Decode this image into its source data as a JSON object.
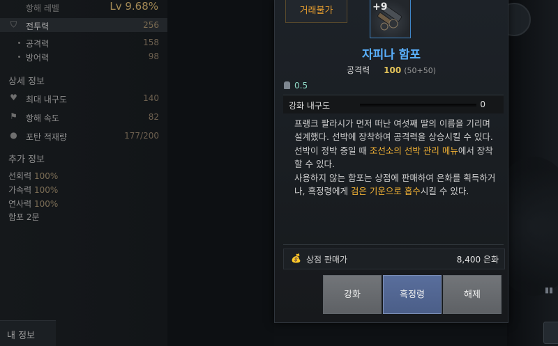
{
  "stats": {
    "level_label": "항해 레벨",
    "level_value": "Lv 9.68%",
    "power_label": "전투력",
    "power_value": "256",
    "attack_label": "공격력",
    "attack_value": "158",
    "defense_label": "방어력",
    "defense_value": "98"
  },
  "details": {
    "heading": "상세 정보",
    "max_durability_label": "최대 내구도",
    "max_durability_value": "140",
    "speed_label": "항해 속도",
    "speed_value": "82",
    "load_label": "포탄 적재량",
    "load_value": "177/200"
  },
  "extra": {
    "heading": "추가 정보",
    "turn_label": "선회력",
    "turn_value": "100%",
    "accel_label": "가속력",
    "accel_value": "100%",
    "firing_label": "연사력",
    "firing_value": "100%",
    "cannon_label": "함포 2문"
  },
  "bottom_tab": "내 정보",
  "tooltip": {
    "trade_tag": "거래불가",
    "enhance_level": "+9",
    "item_name": "자피나 함포",
    "attack_label": "공격력",
    "attack_value": "100",
    "attack_detail": "(50+50)",
    "weight": "0.5",
    "durability_label": "강화 내구도",
    "durability_value": "0",
    "durability_fraction": 0,
    "desc_1": "프랭크 팔라시가 먼저 떠난 여섯째 딸의 이름을 기리며 설계했다. 선박에 장착하여 공격력을 상승시킬 수 있다.",
    "desc_2_a": "선박이 정박 중일 때 ",
    "desc_2_hl": "조선소의 선박 관리 메뉴",
    "desc_2_b": "에서 장착할 수 있다.",
    "desc_3_a": "사용하지 않는 함포는 상점에 판매하여 은화를 획득하거나, 흑정령에게 ",
    "desc_3_hl": "검은 기운으로 흡수",
    "desc_3_b": "시킬 수 있다.",
    "sell_label": "상점 판매가",
    "sell_value": "8,400 은화"
  },
  "buttons": {
    "enhance": "강화",
    "black_spirit": "흑정령",
    "dismantle": "해제"
  },
  "colors": {
    "item_name": "#5ab1ff",
    "highlight": "#f1b135",
    "trade_tag": "#e39b2f"
  }
}
